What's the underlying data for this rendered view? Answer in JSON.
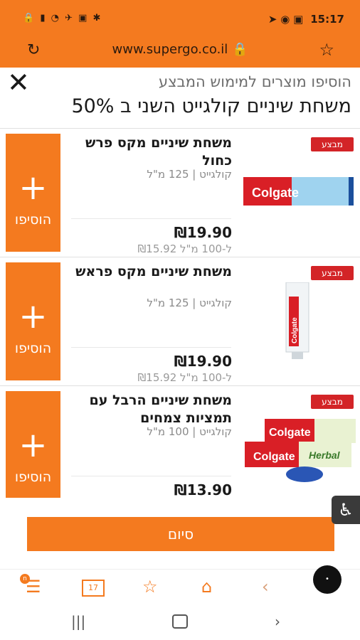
{
  "status": {
    "left_icons": "🔒 ▮ ◔ ✈ ▣ ✱",
    "right_icons": "➤ ◉ ▣",
    "time": "15:17"
  },
  "browser": {
    "url": "www.supergo.co.il 🔒",
    "reload_icon": "reload-icon",
    "star_icon": "star-icon"
  },
  "panel": {
    "subtitle": "הוסיפו מוצרים למימוש המבצע",
    "title": "משחת שיניים קולגייט השני ב 50%",
    "close_glyph": "✕"
  },
  "products": [
    {
      "badge": "מבצע",
      "name": "משחת שיניים מקס פרש כחול",
      "meta": "קולגייט | 125 מ\"ל",
      "price": "₪19.90",
      "unit_price": "₪15.92 ל-100 מ\"ל",
      "add_plus": "+",
      "add_label": "הוסיפו",
      "image_text": "Colgate"
    },
    {
      "badge": "מבצע",
      "name": "משחת שיניים מקס פראש",
      "meta": "קולגייט | 125 מ\"ל",
      "price": "₪19.90",
      "unit_price": "₪15.92 ל-100 מ\"ל",
      "add_plus": "+",
      "add_label": "הוסיפו",
      "image_text": "Colgate"
    },
    {
      "badge": "מבצע",
      "name": "משחת שיניים הרבל עם תמציות צמחים",
      "meta": "קולגייט | 100 מ\"ל",
      "price": "₪13.90",
      "add_plus": "+",
      "add_label": "הוסיפו",
      "image_text": "Colgate",
      "image_text_2": "Herbal"
    }
  ],
  "footer": {
    "done_label": "סיום",
    "accessibility_glyph": "♿"
  },
  "bottom_nav": {
    "menu_badge": "n",
    "cal_day": "17",
    "icons": [
      "menu-icon",
      "calendar-icon",
      "cart-star-icon",
      "home-icon",
      "back-icon",
      "forward-icon"
    ]
  },
  "colors": {
    "brand": "#f47a1f",
    "sale_badge": "#d32427"
  }
}
